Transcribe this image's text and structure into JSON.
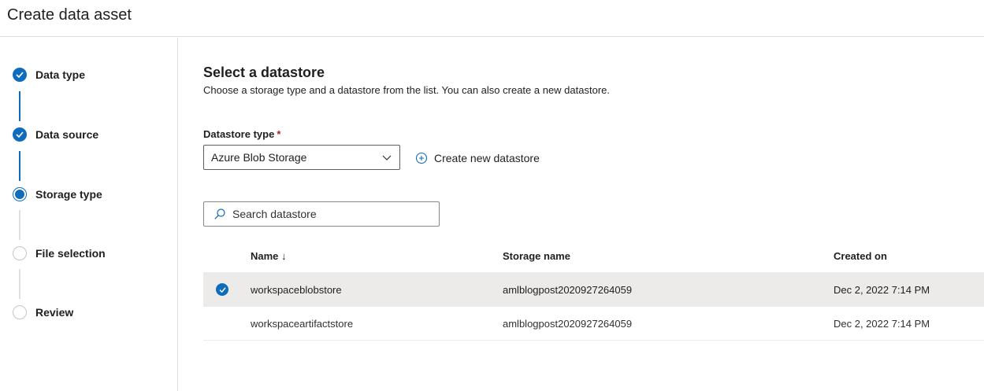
{
  "header": {
    "title": "Create data asset"
  },
  "wizard": {
    "steps": [
      {
        "label": "Data type",
        "status": "done"
      },
      {
        "label": "Data source",
        "status": "done"
      },
      {
        "label": "Storage type",
        "status": "current"
      },
      {
        "label": "File selection",
        "status": "todo"
      },
      {
        "label": "Review",
        "status": "todo"
      }
    ]
  },
  "main": {
    "title": "Select a datastore",
    "description": "Choose a storage type and a datastore from the list. You can also create a new datastore.",
    "datastore_type": {
      "label": "Datastore type",
      "required_mark": "*",
      "value": "Azure Blob Storage"
    },
    "create_link": "Create new datastore",
    "search": {
      "placeholder": "Search datastore"
    },
    "table": {
      "columns": {
        "name": "Name",
        "sort_indicator": "↓",
        "storage": "Storage name",
        "created": "Created on"
      },
      "rows": [
        {
          "name": "workspaceblobstore",
          "storage": "amlblogpost2020927264059",
          "created": "Dec 2, 2022 7:14 PM",
          "selected": true
        },
        {
          "name": "workspaceartifactstore",
          "storage": "amlblogpost2020927264059",
          "created": "Dec 2, 2022 7:14 PM",
          "selected": false
        }
      ]
    }
  },
  "colors": {
    "accent": "#0f6cbd",
    "required": "#a4262c",
    "selected_row": "#edebe9"
  }
}
